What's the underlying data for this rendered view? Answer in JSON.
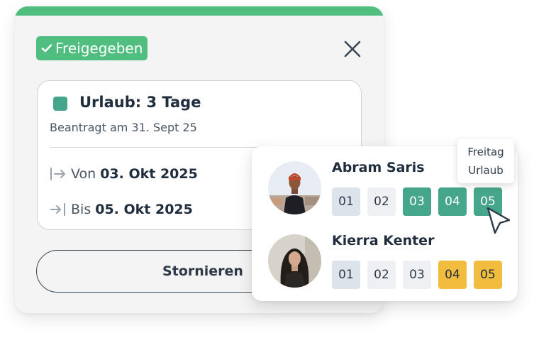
{
  "status_badge": {
    "label": "Freigegeben",
    "color": "#4fbe7e",
    "icon": "check-icon"
  },
  "close_icon": "close-icon",
  "leave": {
    "title": "Urlaub: 3 Tage",
    "requested": "Beantragt am 31. Sept 25",
    "from_label": "Von",
    "from_date": "03. Okt 2025",
    "to_label": "Bis",
    "to_date": "05. Okt 2025",
    "color": "#46a68b"
  },
  "cancel_label": "Stornieren",
  "tooltip": {
    "line1": "Freitag",
    "line2": "Urlaub"
  },
  "people": [
    {
      "name": "Abram Saris",
      "days": [
        {
          "label": "01",
          "state": "weekend"
        },
        {
          "label": "02",
          "state": "normal"
        },
        {
          "label": "03",
          "state": "leave-approved"
        },
        {
          "label": "04",
          "state": "leave-approved"
        },
        {
          "label": "05",
          "state": "leave-approved"
        }
      ]
    },
    {
      "name": "Kierra Kenter",
      "days": [
        {
          "label": "01",
          "state": "weekend"
        },
        {
          "label": "02",
          "state": "normal"
        },
        {
          "label": "03",
          "state": "normal"
        },
        {
          "label": "04",
          "state": "leave-pending"
        },
        {
          "label": "05",
          "state": "leave-pending"
        }
      ]
    }
  ],
  "colors": {
    "approved": "#46a68b",
    "pending": "#f2bd3e",
    "weekend": "#dde3ea",
    "normal": "#eef0f3"
  }
}
